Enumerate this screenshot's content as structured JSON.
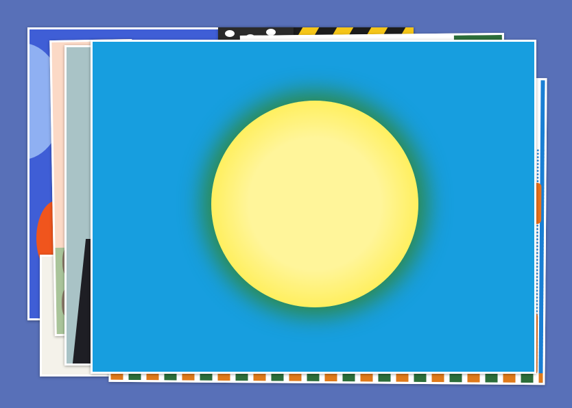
{
  "colors": {
    "background": "#5870b8",
    "card_border": "#ffffff",
    "flag_field": "#179edf",
    "sun_core": "#fff59a",
    "sun_edge": "#ffe91c",
    "sun_glow": "#2e8a4e",
    "card_a_bg": "#3f5ed6",
    "card_a_circle": "#8fb0f2",
    "card_a_blob": "#f0551d",
    "card_b_stripe_dark": "#1c1c1c",
    "card_b_stripe_yellow": "#f5c518",
    "card_c_bg": "#f4f2ea",
    "card_d_bg": "#fbd9c6",
    "card_d_green": "#a9c49a",
    "card_d_rabbit": "#8a7a6a",
    "card_e_bg": "#a9c3c6",
    "card_e_dark": "#1e1e24",
    "card_f_bg": "#2a2a2a",
    "card_f_spot": "#ffffff",
    "card_g_bg": "#ffffff",
    "card_g_leaf": "#2c6e3a",
    "card_h_bg": "#ffffff",
    "card_h_orange": "#e8711c",
    "card_h_blue": "#1a7fd4"
  },
  "icons": {
    "flag": "palau-flag",
    "stack": "photo-stack"
  }
}
